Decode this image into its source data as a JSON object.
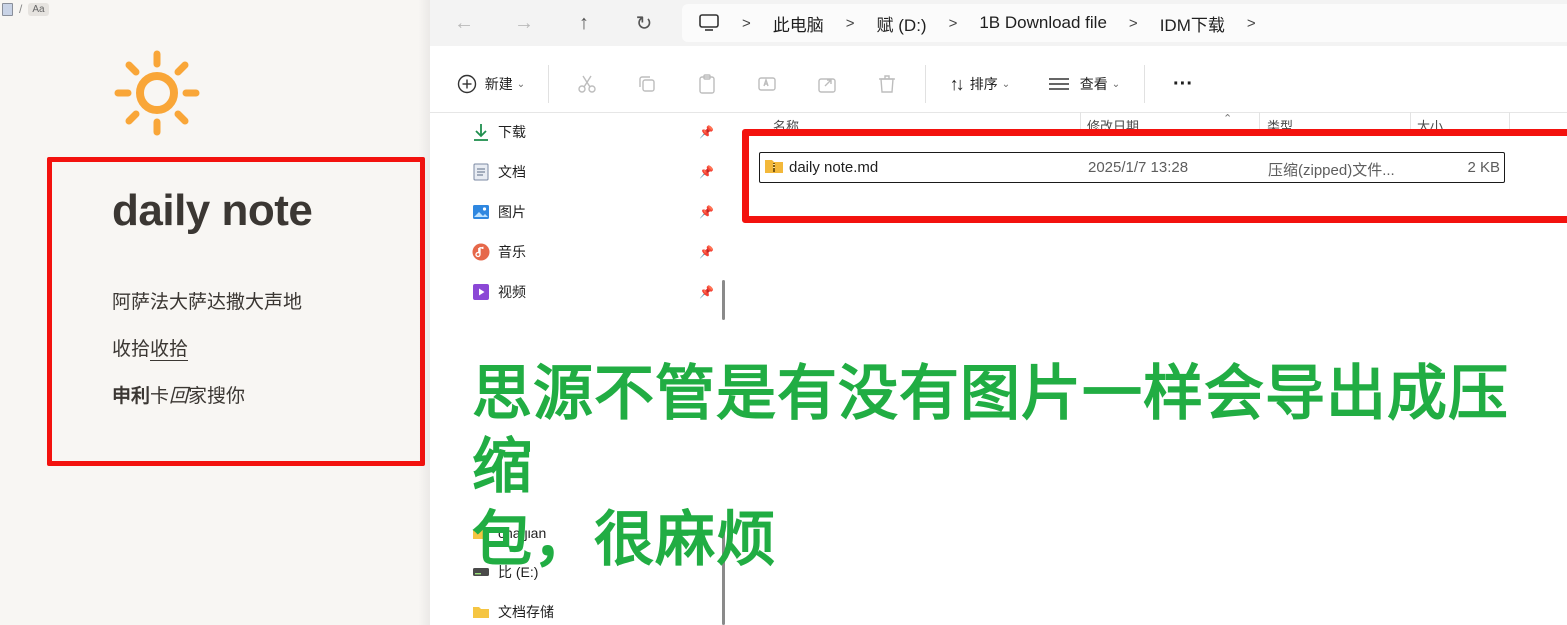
{
  "note": {
    "breadcrumb_separator": "/",
    "font_button": "Aa",
    "title": "daily note",
    "line1": "阿萨法大萨达撒大声地",
    "line2_plain": "收拾",
    "line2_link": "收拾",
    "line3_bold": "申利",
    "line3_plain": "卡",
    "line3_italic": "回",
    "line3_end": "家搜你",
    "sun_color": "#f9a638"
  },
  "explorer": {
    "nav_icons": [
      "back-arrow-icon",
      "forward-arrow-icon",
      "up-arrow-icon",
      "refresh-icon"
    ],
    "address": {
      "crumbs": [
        "此电脑",
        "赋 (D:)",
        "1B Download file",
        "IDM下载"
      ]
    },
    "toolbar": {
      "new_label": "新建",
      "sort_label": "排序",
      "view_label": "查看",
      "more_label": "···"
    },
    "sidebar": {
      "items": [
        {
          "label": "下载",
          "icon": "download-icon"
        },
        {
          "label": "文档",
          "icon": "document-icon"
        },
        {
          "label": "图片",
          "icon": "pictures-icon"
        },
        {
          "label": "音乐",
          "icon": "music-icon"
        },
        {
          "label": "视频",
          "icon": "video-icon"
        },
        {
          "label": "cha jian",
          "icon": "folder-icon"
        },
        {
          "label": "比 (E:)",
          "icon": "drive-icon"
        },
        {
          "label": "文档存储",
          "icon": "folder-icon"
        }
      ]
    },
    "columns": [
      "名称",
      "修改日期",
      "类型",
      "大小"
    ],
    "files": [
      {
        "name": "daily note.md",
        "modified": "2025/1/7 13:28",
        "type": "压缩(zipped)文件...",
        "size": "2 KB"
      }
    ]
  },
  "annotation": {
    "text_line1": "思源不管是有没有图片一样会导出成压缩",
    "text_line2": "包，很麻烦",
    "color": "#21ad43",
    "highlight_color": "#f3120e"
  }
}
